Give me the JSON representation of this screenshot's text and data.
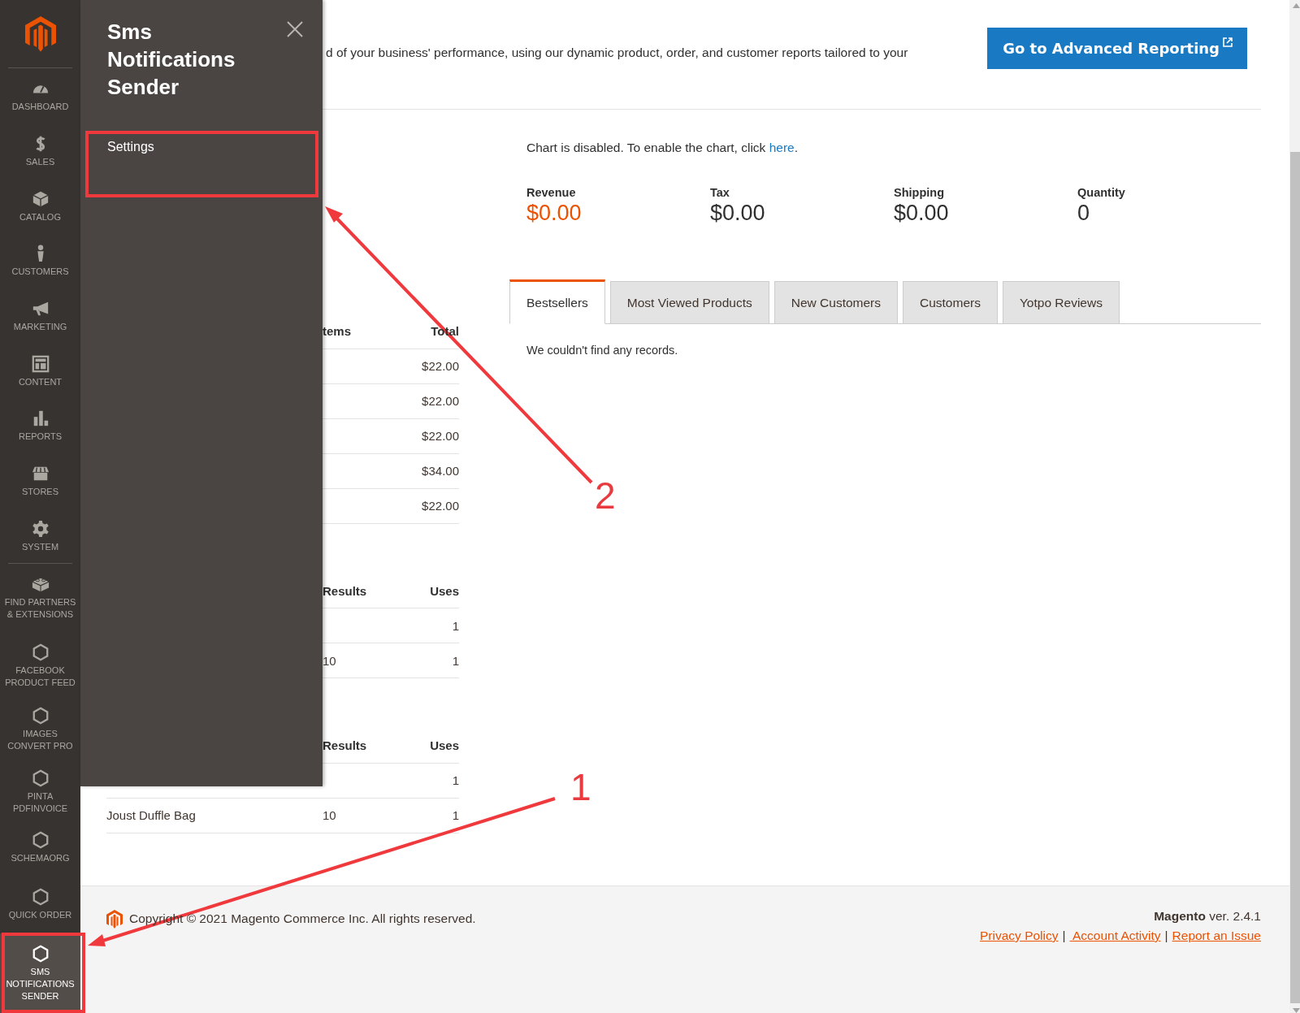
{
  "sidebar": {
    "items": [
      {
        "label": "DASHBOARD",
        "kind": "gauge",
        "selected": false
      },
      {
        "label": "SALES",
        "kind": "dollar",
        "selected": false
      },
      {
        "label": "CATALOG",
        "kind": "box",
        "selected": false
      },
      {
        "label": "CUSTOMERS",
        "kind": "person",
        "selected": false
      },
      {
        "label": "MARKETING",
        "kind": "megaphone",
        "selected": false
      },
      {
        "label": "CONTENT",
        "kind": "layout",
        "selected": false
      },
      {
        "label": "REPORTS",
        "kind": "bars",
        "selected": false
      },
      {
        "label": "STORES",
        "kind": "store",
        "selected": false
      },
      {
        "label": "SYSTEM",
        "kind": "gear",
        "selected": false
      }
    ],
    "extension_items": [
      {
        "label": "FIND PARTNERS & EXTENSIONS",
        "kind": "blocks",
        "selected": false
      },
      {
        "label": "FACEBOOK PRODUCT FEED",
        "kind": "hexagon",
        "selected": false
      },
      {
        "label": "IMAGES CONVERT PRO",
        "kind": "hexagon",
        "selected": false
      },
      {
        "label": "PINTA PDFINVOICE",
        "kind": "hexagon",
        "selected": false
      },
      {
        "label": "SCHEMAORG",
        "kind": "hexagon",
        "selected": false
      },
      {
        "label": "QUICK ORDER",
        "kind": "hexagon",
        "selected": false
      },
      {
        "label": "SMS NOTIFICATIONS SENDER",
        "kind": "hexagon",
        "selected": true
      }
    ]
  },
  "flyout": {
    "title": "Sms Notifications Sender",
    "items": [
      "Settings"
    ]
  },
  "header": {
    "intro": "d of your business' performance, using our dynamic product, order, and customer reports tailored to your",
    "button": "Go to Advanced Reporting"
  },
  "tables": [
    {
      "columns": [
        "",
        "tems",
        "Total"
      ],
      "rows": [
        [
          "",
          "",
          "$22.00"
        ],
        [
          "",
          "",
          "$22.00"
        ],
        [
          "",
          "",
          "$22.00"
        ],
        [
          "",
          "",
          "$34.00"
        ],
        [
          "",
          "",
          "$22.00"
        ]
      ]
    },
    {
      "columns": [
        "",
        "Results",
        "Uses"
      ],
      "rows": [
        [
          "",
          "",
          "1"
        ],
        [
          "",
          "10",
          "1"
        ]
      ]
    },
    {
      "columns": [
        "",
        "Results",
        "Uses"
      ],
      "rows": [
        [
          "",
          "",
          "1"
        ],
        [
          "Joust Duffle Bag",
          "10",
          "1"
        ]
      ]
    }
  ],
  "chart_notice": {
    "text": "Chart is disabled. To enable the chart, click ",
    "link": "here",
    "end": "."
  },
  "stats": [
    {
      "label": "Revenue",
      "value": "$0.00",
      "color": "#eb5202"
    },
    {
      "label": "Tax",
      "value": "$0.00",
      "color": "#303030"
    },
    {
      "label": "Shipping",
      "value": "$0.00",
      "color": "#303030"
    },
    {
      "label": "Quantity",
      "value": "0",
      "color": "#303030"
    }
  ],
  "tabs": [
    {
      "label": "Bestsellers",
      "selected": true
    },
    {
      "label": "Most Viewed Products",
      "selected": false
    },
    {
      "label": "New Customers",
      "selected": false
    },
    {
      "label": "Customers",
      "selected": false
    },
    {
      "label": "Yotpo Reviews",
      "selected": false
    }
  ],
  "tab_content": "We couldn't find any records.",
  "footer": {
    "copyright": "Copyright © 2021 Magento Commerce Inc. All rights reserved.",
    "version": "**Magento** ver. 2.4.1",
    "links": [
      "Privacy Policy",
      " Account Activity",
      "Report an Issue"
    ],
    "separator": "|"
  },
  "annotations": [
    "1",
    "2"
  ]
}
